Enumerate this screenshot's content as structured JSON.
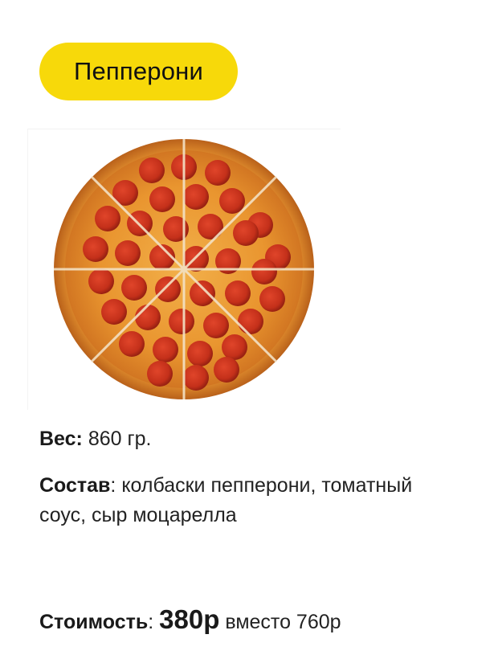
{
  "product": {
    "name": "Пепперони",
    "image_alt": "pizza-pepperoni"
  },
  "details": {
    "weight_label": "Вес:",
    "weight_value": "860 гр.",
    "composition_label": "Состав",
    "composition_value": ": колбаски пепперони, томатный соус, сыр моцарелла"
  },
  "pricing": {
    "label": "Стоимость",
    "separator": ":",
    "new_price": "380р",
    "instead_text": "вместо 760р"
  },
  "colors": {
    "title_background": "#f7d90a",
    "crust": "#d9822b",
    "pepperoni": "#c7311b"
  }
}
